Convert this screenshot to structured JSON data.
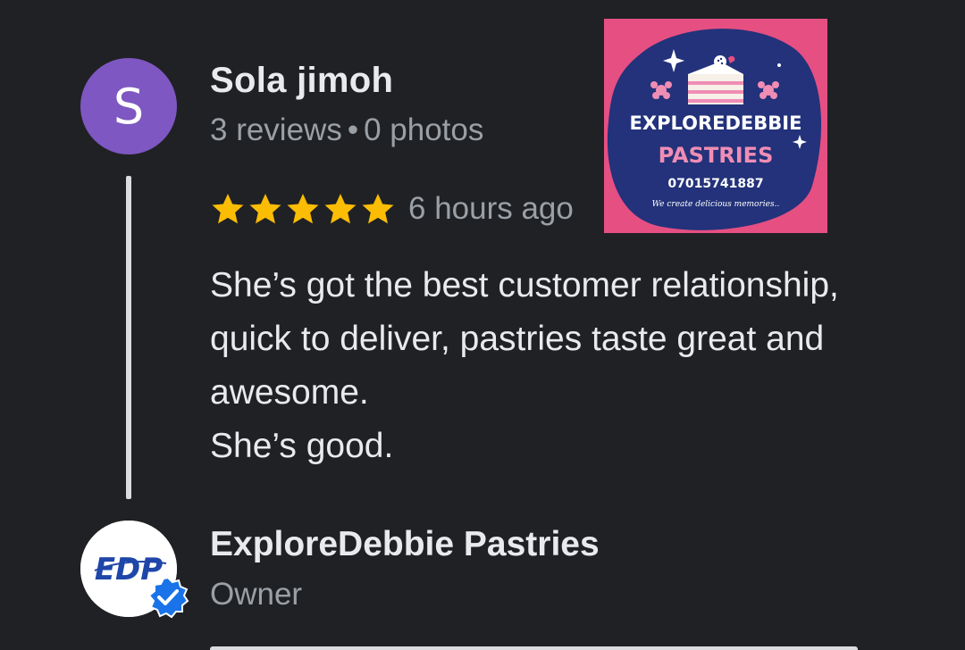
{
  "review": {
    "author_initial": "S",
    "author_name": "Sola jimoh",
    "reviews_count": "3 reviews",
    "separator": "•",
    "photos_count": "0 photos",
    "rating": 5,
    "rating_max": 5,
    "time": "6 hours ago",
    "text": "She’s got the best customer relationship, quick to deliver, pastries taste great and awesome.\nShe’s good.",
    "photo": {
      "title_line1": "EXPLOREDEBBIE",
      "title_line2": "PASTRIES",
      "phone": "07015741887",
      "tagline": "We create delicious memories.."
    }
  },
  "owner": {
    "logo_text": "EDP",
    "name": "ExploreDebbie Pastries",
    "role": "Owner"
  },
  "colors": {
    "background": "#202124",
    "avatar": "#7e57c2",
    "star": "#fbbc04",
    "secondary_text": "#9aa0a6",
    "badge": "#1a73e8",
    "photo_bg": "#e64f82",
    "photo_blob": "#23327a"
  },
  "icons": {
    "star": "star-icon",
    "verified": "verified-badge-icon"
  }
}
